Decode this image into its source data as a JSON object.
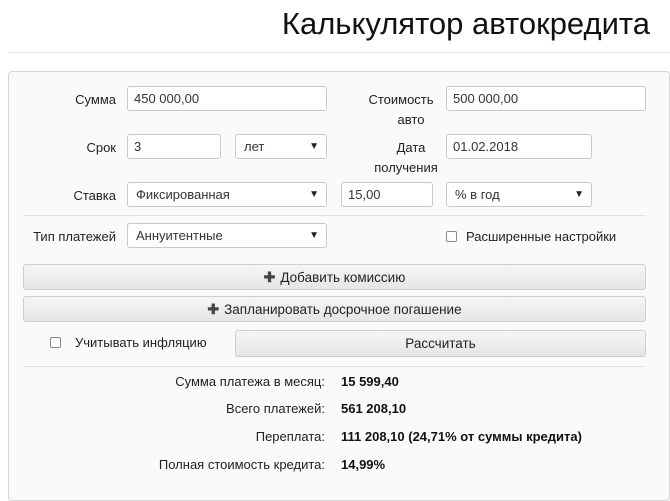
{
  "page": {
    "title": "Калькулятор автокредита"
  },
  "form": {
    "amount": {
      "label": "Сумма",
      "value": "450 000,00"
    },
    "car_cost": {
      "label_line1": "Стоимость",
      "label_line2": "авто",
      "value": "500 000,00"
    },
    "term": {
      "label": "Срок",
      "value": "3",
      "unit": "лет"
    },
    "receive_date": {
      "label_line1": "Дата",
      "label_line2": "получения",
      "value": "01.02.2018"
    },
    "rate": {
      "label": "Ставка",
      "type": "Фиксированная",
      "value": "15,00",
      "unit": "% в год"
    },
    "payment_type": {
      "label": "Тип платежей",
      "value": "Аннуитентные"
    },
    "advanced": {
      "label": "Расширенные настройки"
    },
    "add_commission": "Добавить комиссию",
    "plan_early_repayment": "Запланировать досрочное погашение",
    "inflation": {
      "label": "Учитывать инфляцию"
    },
    "calculate": "Рассчитать"
  },
  "results": [
    {
      "label": "Сумма платежа в месяц:",
      "value": "15 599,40"
    },
    {
      "label": "Всего платежей:",
      "value": "561 208,10"
    },
    {
      "label": "Переплата:",
      "value": "111 208,10 (24,71% от суммы кредита)"
    },
    {
      "label": "Полная стоимость кредита:",
      "value": "14,99%"
    }
  ],
  "icons": {
    "caret": "caret-down-icon",
    "plus": "plus-icon"
  }
}
